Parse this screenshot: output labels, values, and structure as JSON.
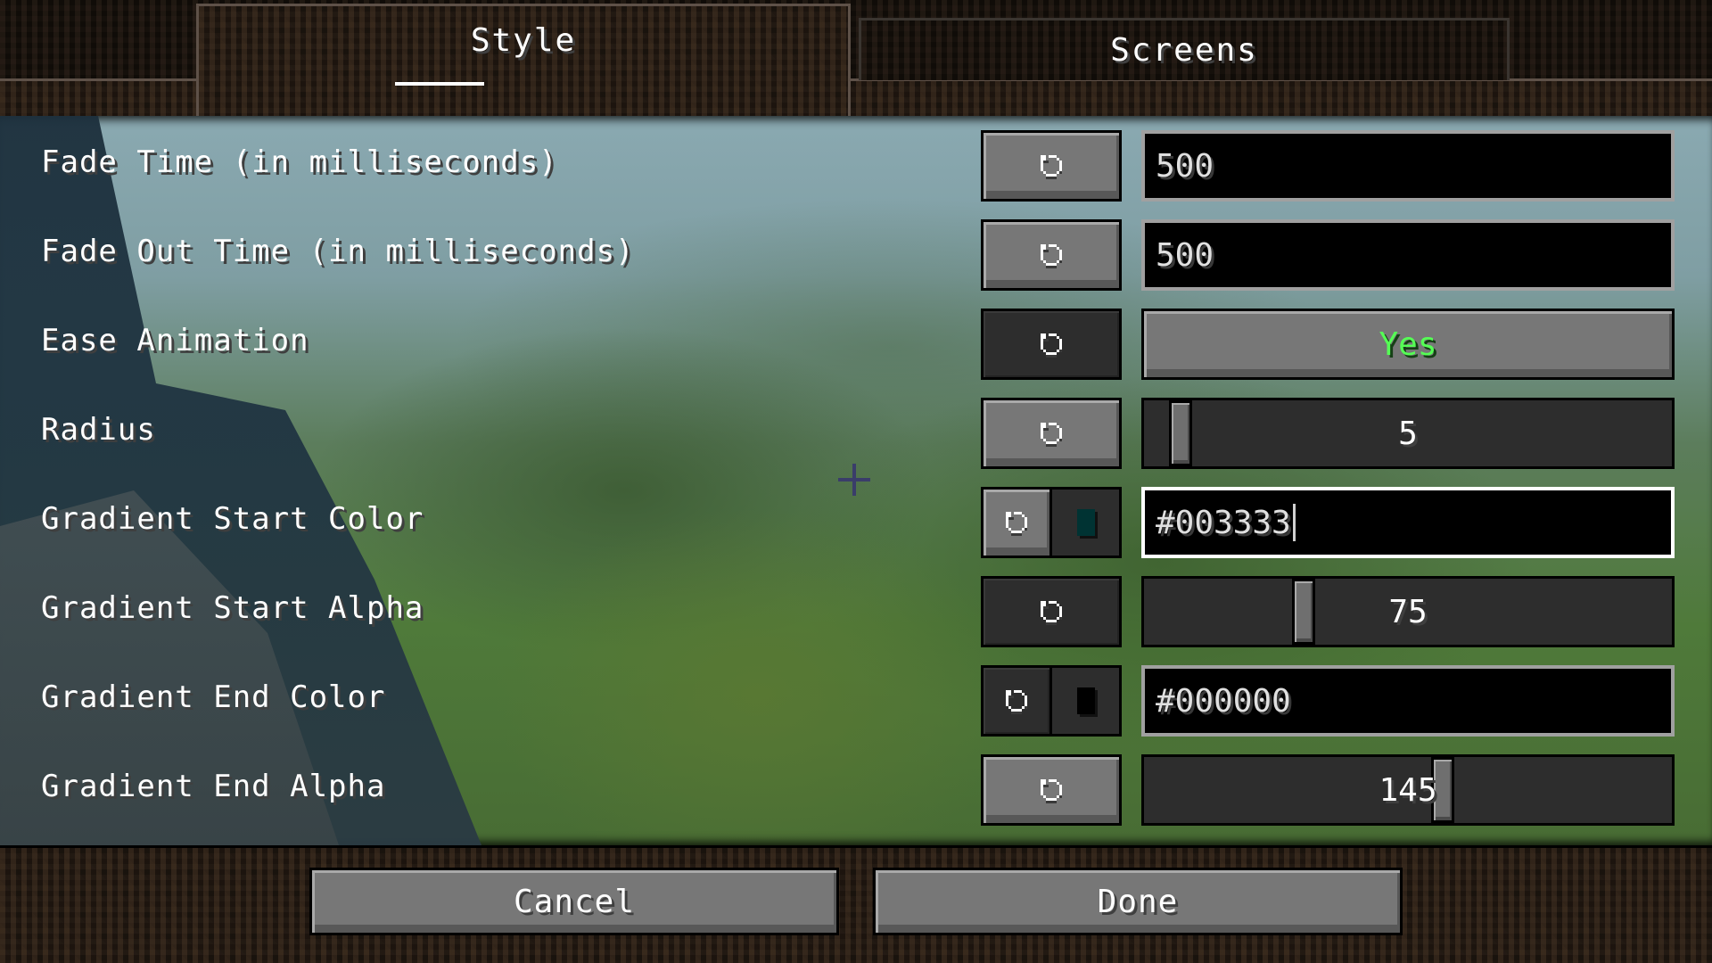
{
  "tabs": [
    {
      "label": "Style",
      "active": true
    },
    {
      "label": "Screens",
      "active": false
    }
  ],
  "icons": {
    "reset": "reset-arrow-icon",
    "crosshair": "crosshair-icon"
  },
  "settings": [
    {
      "label": "Fade Time (in milliseconds)",
      "type": "text",
      "value": "500",
      "reset_enabled": true
    },
    {
      "label": "Fade Out Time (in milliseconds)",
      "type": "text",
      "value": "500",
      "reset_enabled": true
    },
    {
      "label": "Ease Animation",
      "type": "toggle",
      "value": "Yes",
      "value_color": "#55ff55",
      "reset_enabled": false
    },
    {
      "label": "Radius",
      "type": "slider",
      "value": "5",
      "fraction": 0.05,
      "reset_enabled": true
    },
    {
      "label": "Gradient Start Color",
      "type": "color",
      "value": "#003333",
      "swatch_color": "#003333",
      "focused": true,
      "reset_enabled": true
    },
    {
      "label": "Gradient Start Alpha",
      "type": "slider",
      "value": "75",
      "min": 0,
      "max": 255,
      "reset_enabled": false
    },
    {
      "label": "Gradient End Color",
      "type": "color",
      "value": "#000000",
      "swatch_color": "#000000",
      "focused": false,
      "reset_enabled": false
    },
    {
      "label": "Gradient End Alpha",
      "type": "slider",
      "value": "145",
      "min": 0,
      "max": 255,
      "reset_enabled": true
    }
  ],
  "footer": {
    "cancel_label": "Cancel",
    "done_label": "Done"
  }
}
